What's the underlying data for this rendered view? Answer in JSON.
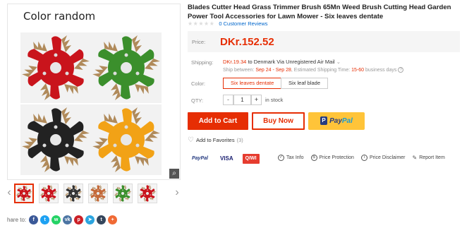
{
  "gallery": {
    "caption": "Color random",
    "blade_colors": [
      "#c9141c",
      "#3b8f2c",
      "#222222",
      "#f2a216"
    ],
    "zoom_icon": "magnifier-icon",
    "nav_prev": "‹",
    "nav_next": "›",
    "thumb_colors": [
      "#c9141c",
      "#c9141c",
      "#333333",
      "#c46a3a",
      "#3b8f2c",
      "#c9141c"
    ]
  },
  "share": {
    "label": "hare to:",
    "icons": [
      {
        "name": "facebook-icon",
        "glyph": "f",
        "color": "#3b5998"
      },
      {
        "name": "twitter-icon",
        "glyph": "t",
        "color": "#1da1f2"
      },
      {
        "name": "whatsapp-icon",
        "glyph": "w",
        "color": "#25d366"
      },
      {
        "name": "vk-icon",
        "glyph": "vk",
        "color": "#4c75a3"
      },
      {
        "name": "pinterest-icon",
        "glyph": "p",
        "color": "#cb2027"
      },
      {
        "name": "telegram-icon",
        "glyph": "➤",
        "color": "#2ca5e0"
      },
      {
        "name": "tumblr-icon",
        "glyph": "t",
        "color": "#35465c"
      },
      {
        "name": "more-icon",
        "glyph": "+",
        "color": "#f06a35"
      }
    ]
  },
  "product": {
    "title": "Blades Cutter Head Grass Trimmer Brush 65Mn Weed Brush Cutting Head Garden Power Tool Accessories for Lawn Mower - Six leaves dentate",
    "stars": "★★★★★",
    "reviews": "0 Customer Reviews",
    "price_label": "Price:",
    "price": "DKr.152.52",
    "shipping_label": "Shipping:",
    "shipping_price": "DKr.19.34",
    "shipping_to": " to Denmark Via Unregistered Air Mail",
    "ship_between_prefix": "Ship between: ",
    "ship_dates": "Sep 24 - Sep 28",
    "est_prefix": ", Estimated Shipping Time: ",
    "est_days": "15-60",
    "est_suffix": " business days",
    "color_label": "Color:",
    "color_options": [
      "Six leaves dentate",
      "Six leaf blade"
    ],
    "color_selected": "Six leaves dentate",
    "qty_label": "QTY:",
    "qty_minus": "-",
    "qty_value": "1",
    "qty_plus": "+",
    "stock": "in stock",
    "add_to_cart": "Add to Cart",
    "buy_now": "Buy Now",
    "paypal_pay": "Pay",
    "paypal_pal": "Pal",
    "favorites": "Add to Favorites",
    "favorites_count": "(3)"
  },
  "payments": {
    "paypal": "PayPal",
    "visa": "VISA",
    "qiwi": "QIWI"
  },
  "info_links": [
    {
      "icon": "shield-icon",
      "label": "Tax Info"
    },
    {
      "icon": "dollar-icon",
      "label": "Price Protection"
    },
    {
      "icon": "info-icon",
      "label": "Price Disclaimer"
    },
    {
      "icon": "pencil-icon",
      "label": "Report Item"
    }
  ]
}
